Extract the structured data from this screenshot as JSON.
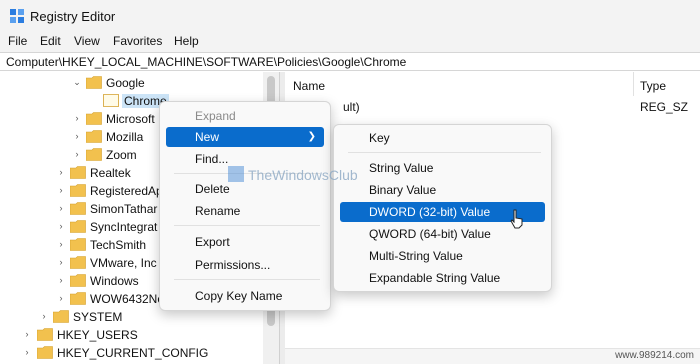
{
  "window": {
    "title": "Registry Editor"
  },
  "menubar": {
    "items": [
      "File",
      "Edit",
      "View",
      "Favorites",
      "Help"
    ]
  },
  "address": {
    "path": "Computer\\HKEY_LOCAL_MACHINE\\SOFTWARE\\Policies\\Google\\Chrome"
  },
  "tree": {
    "items": [
      {
        "label": "Google",
        "chevron": "expanded"
      },
      {
        "label": "Chrome",
        "chevron": "none",
        "selected": true
      },
      {
        "label": "Microsoft",
        "chevron": "collapsed"
      },
      {
        "label": "Mozilla",
        "chevron": "collapsed"
      },
      {
        "label": "Zoom",
        "chevron": "collapsed"
      },
      {
        "label": "Realtek",
        "chevron": "collapsed"
      },
      {
        "label": "RegisteredAp",
        "chevron": "collapsed"
      },
      {
        "label": "SimonTathar",
        "chevron": "collapsed"
      },
      {
        "label": "SyncIntegrat",
        "chevron": "collapsed"
      },
      {
        "label": "TechSmith",
        "chevron": "collapsed"
      },
      {
        "label": "VMware, Inc",
        "chevron": "collapsed"
      },
      {
        "label": "Windows",
        "chevron": "collapsed"
      },
      {
        "label": "WOW6432No",
        "chevron": "collapsed"
      },
      {
        "label": "SYSTEM",
        "chevron": "collapsed"
      },
      {
        "label": "HKEY_USERS",
        "chevron": "collapsed"
      },
      {
        "label": "HKEY_CURRENT_CONFIG",
        "chevron": "collapsed"
      }
    ]
  },
  "values_pane": {
    "headers": {
      "name": "Name",
      "type": "Type"
    },
    "rows": [
      {
        "name": "ult)",
        "type": "REG_SZ"
      }
    ]
  },
  "context_menu": {
    "items": {
      "expand": "Expand",
      "new": "New",
      "find": "Find...",
      "delete": "Delete",
      "rename": "Rename",
      "export": "Export",
      "permissions": "Permissions...",
      "copy_key_name": "Copy Key Name"
    }
  },
  "submenu": {
    "items": {
      "key": "Key",
      "string": "String Value",
      "binary": "Binary Value",
      "dword": "DWORD (32-bit) Value",
      "qword": "QWORD (64-bit) Value",
      "multi": "Multi-String Value",
      "expandable": "Expandable String Value"
    }
  },
  "watermark": {
    "text": "TheWindowsClub"
  },
  "credit": {
    "text": "www.989214.com"
  },
  "colors": {
    "highlight": "#0a6ccc",
    "selection": "#cce4f7",
    "folder": "#f2c14e"
  },
  "icons": [
    "registry-app-icon",
    "folder-icon",
    "chevron-right-icon",
    "chevron-down-icon",
    "submenu-arrow-icon",
    "mouse-cursor-icon"
  ]
}
